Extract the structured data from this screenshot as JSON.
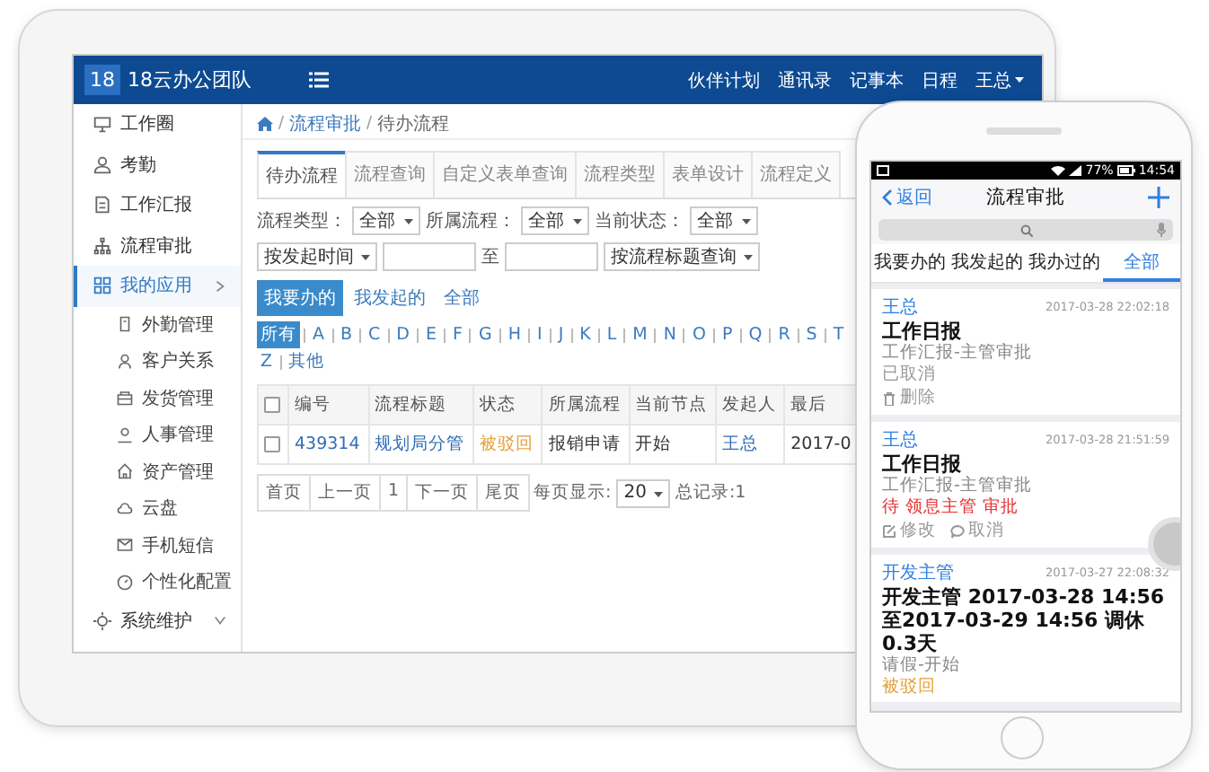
{
  "tablet": {
    "brand": {
      "badge": "18",
      "name": "18云办公团队"
    },
    "top_nav": [
      "伙伴计划",
      "通讯录",
      "记事本",
      "日程"
    ],
    "user": "王总",
    "sidebar": [
      {
        "label": "工作圈",
        "selected": false
      },
      {
        "label": "考勤",
        "selected": false
      },
      {
        "label": "工作汇报",
        "selected": false
      },
      {
        "label": "流程审批",
        "selected": false
      },
      {
        "label": "我的应用",
        "selected": true,
        "expanded": true,
        "children": [
          {
            "label": "外勤管理",
            "selected": false
          },
          {
            "label": "客户关系",
            "selected": false
          },
          {
            "label": "发货管理",
            "selected": false
          },
          {
            "label": "人事管理",
            "selected": false
          },
          {
            "label": "资产管理",
            "selected": false
          },
          {
            "label": "云盘",
            "selected": false
          },
          {
            "label": "手机短信",
            "selected": false
          },
          {
            "label": "个性化配置",
            "selected": false
          }
        ]
      },
      {
        "label": "系统维护",
        "selected": false,
        "expanded": false
      }
    ],
    "breadcrumb": [
      "流程审批",
      "待办流程"
    ],
    "breadcrumb_separator": "/",
    "tabs": [
      {
        "label": "待办流程",
        "selected": true
      },
      {
        "label": "流程查询",
        "selected": false
      },
      {
        "label": "自定义表单查询",
        "selected": false
      },
      {
        "label": "流程类型",
        "selected": false
      },
      {
        "label": "表单设计",
        "selected": false
      },
      {
        "label": "流程定义",
        "selected": false
      }
    ],
    "filters": [
      {
        "label": "流程类型：",
        "value": "全部"
      },
      {
        "label": "所属流程：",
        "value": "全部"
      },
      {
        "label": "当前状态：",
        "value": "全部"
      }
    ],
    "date_filter": {
      "value": "按发起时间",
      "to": "至"
    },
    "title_filter": {
      "value": "按流程标题查询"
    },
    "scope_buttons": [
      {
        "label": "我要办的",
        "selected": true
      },
      {
        "label": "我发起的",
        "selected": false
      },
      {
        "label": "全部",
        "selected": false
      }
    ],
    "letter_rows": [
      [
        {
          "label": "所有",
          "selected": true
        },
        {
          "label": "A",
          "selected": false
        },
        {
          "label": "B",
          "selected": false
        },
        {
          "label": "C",
          "selected": false
        },
        {
          "label": "D",
          "selected": false
        },
        {
          "label": "E",
          "selected": false
        },
        {
          "label": "F",
          "selected": false
        },
        {
          "label": "G",
          "selected": false
        },
        {
          "label": "H",
          "selected": false
        },
        {
          "label": "I",
          "selected": false
        },
        {
          "label": "J",
          "selected": false
        },
        {
          "label": "K",
          "selected": false
        },
        {
          "label": "L",
          "selected": false
        },
        {
          "label": "M",
          "selected": false
        },
        {
          "label": "N",
          "selected": false
        },
        {
          "label": "O",
          "selected": false
        },
        {
          "label": "P",
          "selected": false
        },
        {
          "label": "Q",
          "selected": false
        },
        {
          "label": "R",
          "selected": false
        },
        {
          "label": "S",
          "selected": false
        },
        {
          "label": "T",
          "selected": false
        }
      ],
      [
        {
          "label": "Z",
          "selected": false
        },
        {
          "label": "其他",
          "selected": false
        }
      ]
    ],
    "table": {
      "header_checked": false,
      "columns": [
        {
          "label": "编号",
          "kind": "link"
        },
        {
          "label": "流程标题",
          "kind": "link"
        },
        {
          "label": "状态",
          "kind": "status"
        },
        {
          "label": "所属流程",
          "kind": "text"
        },
        {
          "label": "当前节点",
          "kind": "text"
        },
        {
          "label": "发起人",
          "kind": "link"
        },
        {
          "label": "最后",
          "kind": "text"
        }
      ],
      "rows": [
        {
          "checked": false,
          "cells": [
            "439314",
            "规划局分管",
            "被驳回",
            "报销申请",
            "开始",
            "王总",
            "2017-0"
          ]
        }
      ]
    },
    "pagination": {
      "buttons": [
        "首页",
        "上一页",
        "1",
        "下一页",
        "尾页"
      ],
      "per_page_label": "每页显示:",
      "per_page": "20",
      "total": "总记录:1"
    }
  },
  "phone": {
    "status_bar": {
      "battery": "77%",
      "time": "14:54"
    },
    "nav": {
      "back": "返回",
      "title": "流程审批"
    },
    "tabs": [
      {
        "label": "我要办的",
        "selected": false
      },
      {
        "label": "我发起的",
        "selected": false
      },
      {
        "label": "我办过的",
        "selected": false
      },
      {
        "label": "全部",
        "selected": true
      }
    ],
    "cards": [
      {
        "author": "王总",
        "time": "2017-03-28 22:02:18",
        "title": "工作日报",
        "subtitle": "工作汇报-主管审批",
        "status": {
          "text": "已取消",
          "kind": "cancelled"
        },
        "actions": [
          {
            "label": "删除",
            "kind": "delete"
          }
        ]
      },
      {
        "author": "王总",
        "time": "2017-03-28 21:51:59",
        "title": "工作日报",
        "subtitle": "工作汇报-主管审批",
        "status": {
          "text": "待 领息主管 审批",
          "kind": "pending"
        },
        "actions": [
          {
            "label": "修改",
            "kind": "edit"
          },
          {
            "label": "取消",
            "kind": "cancel"
          }
        ]
      },
      {
        "author": "开发主管",
        "time": "2017-03-27 22:08:32",
        "title": "开发主管 2017-03-28 14:56至2017-03-29 14:56 调休0.3天",
        "subtitle": "请假-开始",
        "status": {
          "text": "被驳回",
          "kind": "rejected"
        }
      }
    ]
  }
}
